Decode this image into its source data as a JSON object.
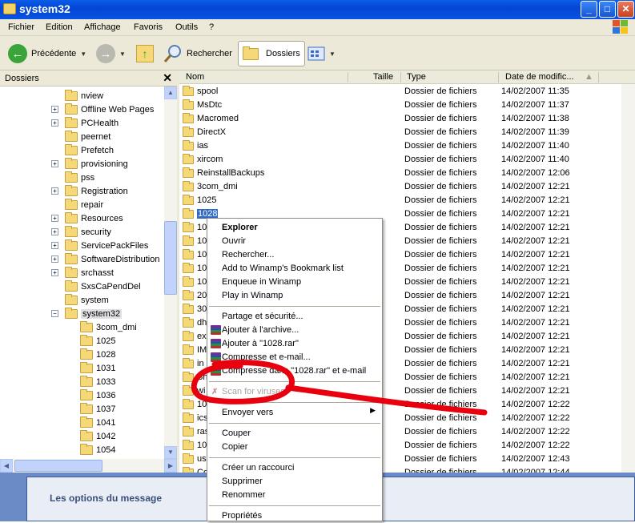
{
  "window": {
    "title": "system32",
    "buttons": {
      "minimize": "_",
      "maximize": "□",
      "close": "✕"
    }
  },
  "menubar": [
    "Fichier",
    "Edition",
    "Affichage",
    "Favoris",
    "Outils",
    "?"
  ],
  "toolbar": {
    "back_label": "Précédente",
    "search_label": "Rechercher",
    "folders_label": "Dossiers"
  },
  "folders_pane": {
    "title": "Dossiers",
    "close": "✕",
    "items": [
      {
        "label": "nview",
        "expander": ""
      },
      {
        "label": "Offline Web Pages",
        "expander": "+"
      },
      {
        "label": "PCHealth",
        "expander": "+"
      },
      {
        "label": "peernet",
        "expander": ""
      },
      {
        "label": "Prefetch",
        "expander": ""
      },
      {
        "label": "provisioning",
        "expander": "+"
      },
      {
        "label": "pss",
        "expander": ""
      },
      {
        "label": "Registration",
        "expander": "+"
      },
      {
        "label": "repair",
        "expander": ""
      },
      {
        "label": "Resources",
        "expander": "+"
      },
      {
        "label": "security",
        "expander": "+"
      },
      {
        "label": "ServicePackFiles",
        "expander": "+"
      },
      {
        "label": "SoftwareDistribution",
        "expander": "+"
      },
      {
        "label": "srchasst",
        "expander": "+"
      },
      {
        "label": "SxsCaPendDel",
        "expander": ""
      },
      {
        "label": "system",
        "expander": ""
      },
      {
        "label": "system32",
        "expander": "−"
      }
    ],
    "children": [
      "3com_dmi",
      "1025",
      "1028",
      "1031",
      "1033",
      "1036",
      "1037",
      "1041",
      "1042",
      "1054"
    ]
  },
  "columns": {
    "name": "Nom",
    "size": "Taille",
    "type": "Type",
    "date": "Date de modific..."
  },
  "files": [
    {
      "name": "spool",
      "type": "Dossier de fichiers",
      "date": "14/02/2007 11:35"
    },
    {
      "name": "MsDtc",
      "type": "Dossier de fichiers",
      "date": "14/02/2007 11:37"
    },
    {
      "name": "Macromed",
      "type": "Dossier de fichiers",
      "date": "14/02/2007 11:38"
    },
    {
      "name": "DirectX",
      "type": "Dossier de fichiers",
      "date": "14/02/2007 11:39"
    },
    {
      "name": "ias",
      "type": "Dossier de fichiers",
      "date": "14/02/2007 11:40"
    },
    {
      "name": "xircom",
      "type": "Dossier de fichiers",
      "date": "14/02/2007 11:40"
    },
    {
      "name": "ReinstallBackups",
      "type": "Dossier de fichiers",
      "date": "14/02/2007 12:06"
    },
    {
      "name": "3com_dmi",
      "type": "Dossier de fichiers",
      "date": "14/02/2007 12:21"
    },
    {
      "name": "1025",
      "type": "Dossier de fichiers",
      "date": "14/02/2007 12:21"
    },
    {
      "name": "1028",
      "type": "Dossier de fichiers",
      "date": "14/02/2007 12:21"
    },
    {
      "name": "10",
      "type": "Dossier de fichiers",
      "date": "14/02/2007 12:21"
    },
    {
      "name": "10",
      "type": "Dossier de fichiers",
      "date": "14/02/2007 12:21"
    },
    {
      "name": "10",
      "type": "Dossier de fichiers",
      "date": "14/02/2007 12:21"
    },
    {
      "name": "10",
      "type": "Dossier de fichiers",
      "date": "14/02/2007 12:21"
    },
    {
      "name": "10",
      "type": "Dossier de fichiers",
      "date": "14/02/2007 12:21"
    },
    {
      "name": "20",
      "type": "Dossier de fichiers",
      "date": "14/02/2007 12:21"
    },
    {
      "name": "30",
      "type": "Dossier de fichiers",
      "date": "14/02/2007 12:21"
    },
    {
      "name": "dh",
      "type": "Dossier de fichiers",
      "date": "14/02/2007 12:21"
    },
    {
      "name": "ex",
      "type": "Dossier de fichiers",
      "date": "14/02/2007 12:21"
    },
    {
      "name": "IM",
      "type": "Dossier de fichiers",
      "date": "14/02/2007 12:21"
    },
    {
      "name": "in",
      "type": "Dossier de fichiers",
      "date": "14/02/2007 12:21"
    },
    {
      "name": "Sh",
      "type": "Dossier de fichiers",
      "date": "14/02/2007 12:21"
    },
    {
      "name": "wi",
      "type": "Dossier de fichiers",
      "date": "14/02/2007 12:21"
    },
    {
      "name": "10",
      "type": "Dossier de fichiers",
      "date": "14/02/2007 12:22"
    },
    {
      "name": "ics",
      "type": "Dossier de fichiers",
      "date": "14/02/2007 12:22"
    },
    {
      "name": "ras",
      "type": "Dossier de fichiers",
      "date": "14/02/2007 12:22"
    },
    {
      "name": "10",
      "type": "Dossier de fichiers",
      "date": "14/02/2007 12:22"
    },
    {
      "name": "us",
      "type": "Dossier de fichiers",
      "date": "14/02/2007 12:43"
    },
    {
      "name": "Co",
      "type": "Dossier de fichiers",
      "date": "14/02/2007 12:44"
    }
  ],
  "context_menu": {
    "items": [
      {
        "label": "Explorer",
        "style": "bold"
      },
      {
        "label": "Ouvrir"
      },
      {
        "label": "Rechercher..."
      },
      {
        "label": "Add to Winamp's Bookmark list"
      },
      {
        "label": "Enqueue in Winamp"
      },
      {
        "label": "Play in Winamp"
      },
      {
        "sep": true
      },
      {
        "label": "Partage et sécurité..."
      },
      {
        "label": "Ajouter à l'archive...",
        "icon": "rar"
      },
      {
        "label": "Ajouter à \"1028.rar\"",
        "icon": "rar"
      },
      {
        "label": "Compresse et e-mail...",
        "icon": "rar"
      },
      {
        "label": "Compresse dans \"1028.rar\" et e-mail",
        "icon": "rar"
      },
      {
        "sep": true
      },
      {
        "label": "Scan for viruses",
        "style": "disabled",
        "icon": "scan"
      },
      {
        "sep": true
      },
      {
        "label": "Envoyer vers",
        "submenu": "▶"
      },
      {
        "sep": true
      },
      {
        "label": "Couper"
      },
      {
        "label": "Copier"
      },
      {
        "sep": true
      },
      {
        "label": "Créer un raccourci"
      },
      {
        "label": "Supprimer"
      },
      {
        "label": "Renommer"
      },
      {
        "sep": true
      },
      {
        "label": "Propriétés"
      }
    ]
  },
  "web_page": {
    "message_options": "Les options du message"
  },
  "colors": {
    "xp_blue": "#0a5de8",
    "selection": "#316ac5",
    "annotation_red": "#e8000f",
    "folder": "#f5d877"
  }
}
